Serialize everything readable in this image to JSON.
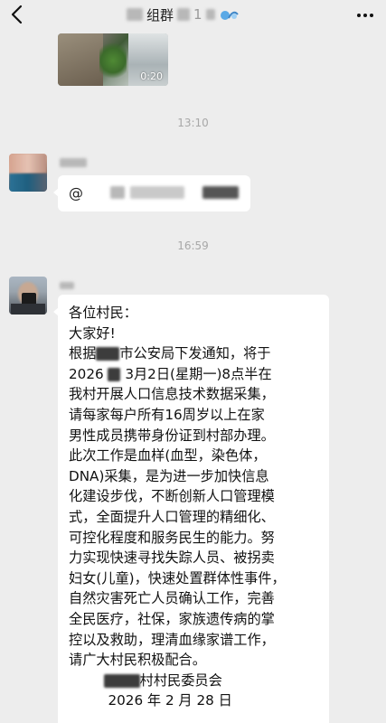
{
  "header": {
    "back_icon": "chevron-left-icon",
    "title_visible": "组群",
    "title_suffix": "1",
    "more_icon": "ellipsis-icon"
  },
  "messages": [
    {
      "type": "video",
      "duration": "0:20"
    },
    {
      "type": "time",
      "text": "13:10"
    },
    {
      "type": "text",
      "mention_prefix": "@"
    },
    {
      "type": "time",
      "text": "16:59"
    },
    {
      "type": "text",
      "lines": [
        "各位村民：",
        "大家好!",
        "根据",
        "市公安局下发通知，将于",
        "2026",
        "3月2日(星期一)8点半在",
        "我村开展人口信息技术数据采集，",
        "请每家每户所有16周岁以上在家",
        "男性成员携带身份证到村部办理。",
        "此次工作是血样(血型，染色体，",
        "DNA)采集，是为进一步加快信息",
        "化建设步伐，不断创新人口管理模",
        "式，全面提升人口管理的精细化、",
        "可控化程度和服务民生的能力。努",
        "力实现快速寻找失踪人员、被拐卖",
        "妇女(儿童)，快速处置群体性事件，",
        "自然灾害死亡人员确认工作，完善",
        "全民医疗，社保，家族遗传病的掌",
        "控以及救助，理清血缘家谱工作，",
        "请广大村民积极配合。"
      ],
      "signature": "村村民委员会",
      "date_partial": "2026 年 2 月 28 日"
    }
  ]
}
